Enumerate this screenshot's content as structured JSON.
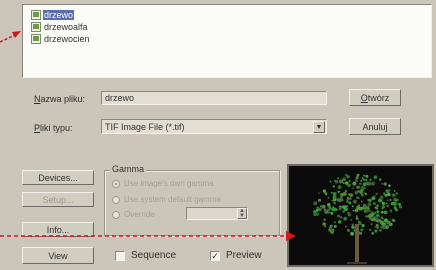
{
  "files": [
    {
      "name": "drzewo",
      "selected": true
    },
    {
      "name": "drzewoalfa",
      "selected": false
    },
    {
      "name": "drzewocien",
      "selected": false
    }
  ],
  "filename": {
    "label_underlined": "N",
    "label_rest": "azwa pliku:",
    "value": "drzewo"
  },
  "filetype": {
    "label_underlined": "P",
    "label_rest": "liki typu:",
    "value": "TIF Image File (*.tif)",
    "arrow": "▼"
  },
  "buttons": {
    "open": {
      "underlined": "O",
      "rest": "twórz"
    },
    "cancel": "Anuluj",
    "devices": "Devices...",
    "setup": "Setup...",
    "info": "Info...",
    "view": "View"
  },
  "gamma": {
    "title": "Gamma",
    "options": [
      "Use image's own gamma",
      "Use system default gamma",
      "Override"
    ],
    "selected_index": 0,
    "override_value": ""
  },
  "checks": {
    "sequence": {
      "label": "Sequence",
      "checked": false
    },
    "preview": {
      "label": "Preview",
      "checked": true,
      "mark": "✓"
    }
  },
  "colors": {
    "selection": "#5a6db0",
    "arrow": "#d01818",
    "preview_bg": "#0b0b0b",
    "foliage": "#4d8a3b"
  }
}
